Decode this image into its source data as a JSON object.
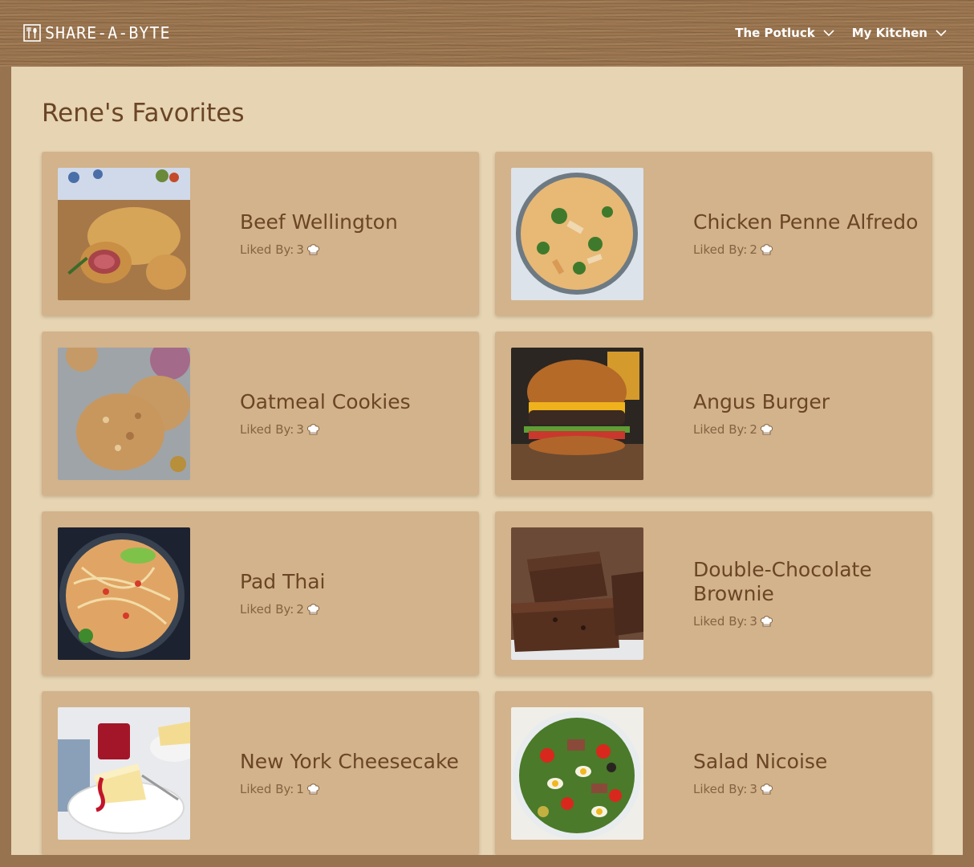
{
  "app": {
    "brand": "SHARE-A-BYTE",
    "logo_icon": "fork-spoon-icon"
  },
  "nav": [
    {
      "label": "The Potluck",
      "icon": "chevron-down-icon"
    },
    {
      "label": "My Kitchen",
      "icon": "chevron-down-icon"
    }
  ],
  "page": {
    "title": "Rene's Favorites"
  },
  "liked_by_label": "Liked By:",
  "recipes": [
    {
      "name": "Beef Wellington",
      "likes": "3",
      "photo": "beef-wellington"
    },
    {
      "name": "Chicken Penne Alfredo",
      "likes": "2",
      "photo": "chicken-penne-alfredo"
    },
    {
      "name": "Oatmeal Cookies",
      "likes": "3",
      "photo": "oatmeal-cookies"
    },
    {
      "name": "Angus Burger",
      "likes": "2",
      "photo": "angus-burger"
    },
    {
      "name": "Pad Thai",
      "likes": "2",
      "photo": "pad-thai"
    },
    {
      "name": "Double-Chocolate Brownie",
      "likes": "3",
      "photo": "double-chocolate-brownie"
    },
    {
      "name": "New York Cheesecake",
      "likes": "1",
      "photo": "new-york-cheesecake"
    },
    {
      "name": "Salad Nicoise",
      "likes": "3",
      "photo": "salad-nicoise"
    }
  ],
  "colors": {
    "header_wood": "#9a7550",
    "page_background": "#e6d4b2",
    "card": "#d2b38b",
    "title_text": "#6b4526",
    "muted_text": "#856343"
  }
}
